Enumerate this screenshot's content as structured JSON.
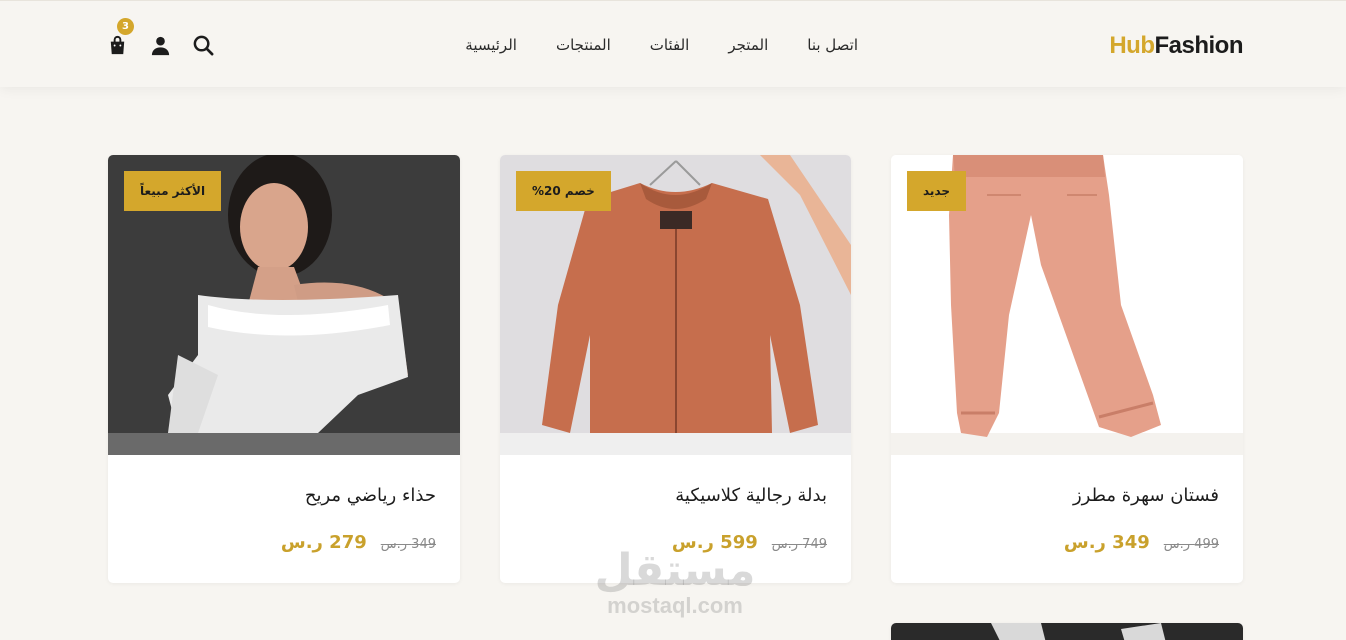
{
  "header": {
    "logo_part1": "Hub",
    "logo_part2": "Fashion",
    "nav": [
      "الرئيسية",
      "المنتجات",
      "الفئات",
      "المتجر",
      "اتصل بنا"
    ],
    "cart_count": "3"
  },
  "icons": [
    "shopping-bag-icon",
    "user-icon",
    "search-icon"
  ],
  "colors": {
    "accent": "#d4a72c",
    "background": "#f7f5f1",
    "price": "#c9a12c"
  },
  "products": [
    {
      "tag": "جديد",
      "title": "فستان سهرة مطرز",
      "price": "349 ر.س",
      "old_price": "499 ر.س"
    },
    {
      "tag": "خصم 20%",
      "title": "بدلة رجالية كلاسيكية",
      "price": "599 ر.س",
      "old_price": "749 ر.س"
    },
    {
      "tag": "الأكثر مبيعاً",
      "title": "حذاء رياضي مريح",
      "price": "279 ر.س",
      "old_price": "349 ر.س"
    }
  ],
  "watermark": {
    "arabic": "مستقل",
    "latin": "mostaql.com"
  }
}
